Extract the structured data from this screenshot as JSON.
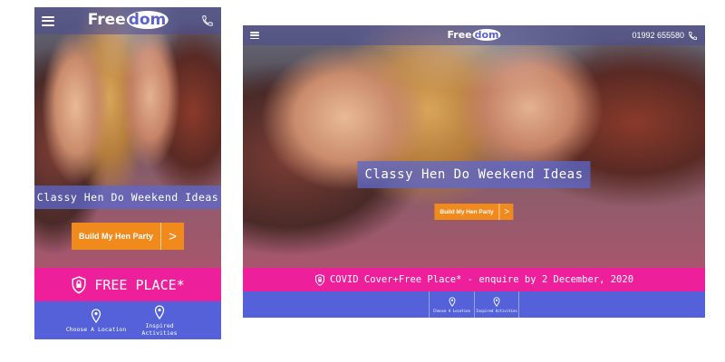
{
  "brand": {
    "logo_prefix": "Free",
    "logo_suffix": "dom",
    "phone": "01992 655580"
  },
  "hero": {
    "headline": "Classy Hen Do Weekend Ideas",
    "cta_label": "Build My Hen Party",
    "cta_arrow": ">"
  },
  "mobile_banner": {
    "text": "FREE PLACE*"
  },
  "desktop_banner": {
    "text": "COVID Cover+Free Place* - enquire by 2 December, 2020"
  },
  "nav": {
    "items": [
      {
        "label": "Choose A Location",
        "icon": "map-pin-icon"
      },
      {
        "label": "Inspired Activities",
        "icon": "map-pin-icon"
      }
    ]
  },
  "colors": {
    "header_overlay": "#4a4a96",
    "headline_bg": "#5c68cc",
    "cta": "#f08a1d",
    "pink_banner": "#ee1f9a",
    "blue_bar": "#5561d8"
  }
}
